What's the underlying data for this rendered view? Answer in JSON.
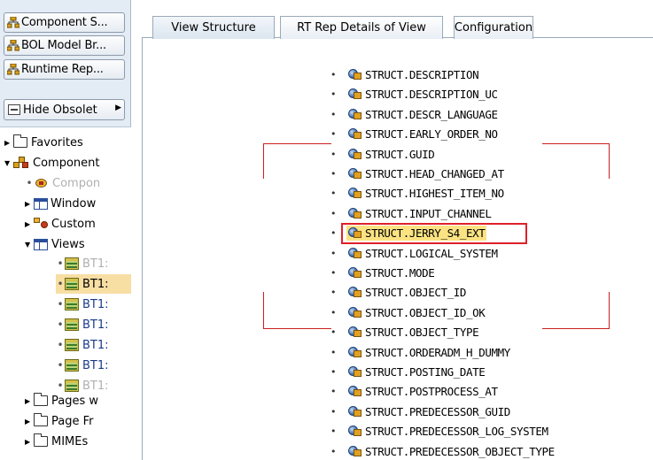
{
  "left_panel": {
    "buttons": [
      {
        "label": "Component S...",
        "icon": "structure-icon"
      },
      {
        "label": "BOL Model Br...",
        "icon": "structure-icon"
      },
      {
        "label": "Runtime Rep...",
        "icon": "structure-icon"
      }
    ],
    "hide_obsolete_label": "Hide Obsolet",
    "tree": {
      "favorites": "Favorites",
      "component": "Component",
      "compon": "Compon",
      "window": "Window",
      "custom": "Custom",
      "views": "Views",
      "view_items": [
        "BT1:",
        "BT1:",
        "BT1:",
        "BT1:",
        "BT1:",
        "BT1:",
        "BT1:"
      ],
      "pages": "Pages w",
      "page_fr": "Page Fr",
      "mimes": "MIMEs"
    }
  },
  "tabs": [
    {
      "label": "View Structure",
      "active": true
    },
    {
      "label": "RT Rep Details of View",
      "active": false
    },
    {
      "label": "Configuration",
      "active": false
    }
  ],
  "attributes": [
    "STRUCT.DESCRIPTION",
    "STRUCT.DESCRIPTION_UC",
    "STRUCT.DESCR_LANGUAGE",
    "STRUCT.EARLY_ORDER_NO",
    "STRUCT.GUID",
    "STRUCT.HEAD_CHANGED_AT",
    "STRUCT.HIGHEST_ITEM_NO",
    "STRUCT.INPUT_CHANNEL",
    "STRUCT.JERRY_S4_EXT",
    "STRUCT.LOGICAL_SYSTEM",
    "STRUCT.MODE",
    "STRUCT.OBJECT_ID",
    "STRUCT.OBJECT_ID_OK",
    "STRUCT.OBJECT_TYPE",
    "STRUCT.ORDERADM_H_DUMMY",
    "STRUCT.POSTING_DATE",
    "STRUCT.POSTPROCESS_AT",
    "STRUCT.PREDECESSOR_GUID",
    "STRUCT.PREDECESSOR_LOG_SYSTEM",
    "STRUCT.PREDECESSOR_OBJECT_TYPE"
  ],
  "highlighted_attribute": "STRUCT.JERRY_S4_EXT",
  "colors": {
    "panel_bg": "#e3ebf4",
    "highlight_fill": "#fbe383",
    "highlight_border": "#e0202a",
    "selected_row": "#f7dea3"
  }
}
